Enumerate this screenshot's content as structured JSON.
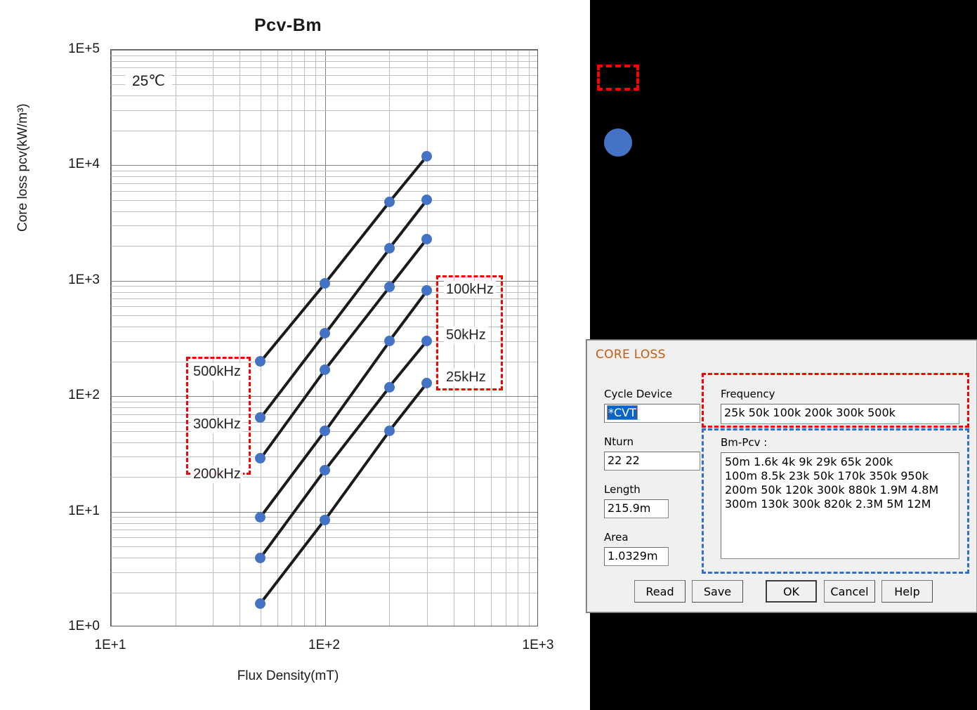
{
  "chart_data": {
    "type": "line",
    "title": "Pcv-Bm",
    "xlabel": "Flux Density(mT)",
    "ylabel": "Core loss pcv(kW/m³)",
    "annotation": "25℃",
    "xscale": "log",
    "yscale": "log",
    "xlim": [
      10,
      1000
    ],
    "ylim": [
      1,
      100000
    ],
    "grid": true,
    "xtick_labels": [
      "1E+1",
      "1E+2",
      "1E+3"
    ],
    "ytick_labels": [
      "1E+0",
      "1E+1",
      "1E+2",
      "1E+3",
      "1E+4",
      "1E+5"
    ],
    "x": [
      50,
      100,
      200,
      300
    ],
    "marker_color": "#4472C4",
    "line_color": "#1a1a1a",
    "legend_position": "inline-labels",
    "series": [
      {
        "name": "25kHz",
        "label_side": "right",
        "values": [
          1.6,
          8.5,
          50,
          130
        ]
      },
      {
        "name": "50kHz",
        "label_side": "right",
        "values": [
          4,
          23,
          120,
          300
        ]
      },
      {
        "name": "100kHz",
        "label_side": "right",
        "values": [
          9,
          50,
          300,
          820
        ]
      },
      {
        "name": "200kHz",
        "label_side": "left",
        "values": [
          29,
          170,
          880,
          2300
        ]
      },
      {
        "name": "300kHz",
        "label_side": "left",
        "values": [
          65,
          350,
          1900,
          5000
        ]
      },
      {
        "name": "500kHz",
        "label_side": "left",
        "values": [
          200,
          950,
          4800,
          12000
        ]
      }
    ],
    "left_label_group": [
      "500kHz",
      "300kHz",
      "200kHz"
    ],
    "right_label_group": [
      "100kHz",
      "50kHz",
      "25kHz"
    ]
  },
  "dialog": {
    "title": "CORE LOSS",
    "fields": [
      {
        "label": "Cycle Device",
        "value": "*CVT",
        "selected": true
      },
      {
        "label": "Nturn",
        "value": "22 22",
        "selected": false
      },
      {
        "label": "Length",
        "value": "215.9m",
        "selected": false
      },
      {
        "label": "Area",
        "value": "1.0329m",
        "selected": false
      }
    ],
    "frequency": {
      "label": "Frequency",
      "value": "25k 50k 100k 200k 300k 500k"
    },
    "bm_pcv": {
      "label": "Bm-Pcv :",
      "lines": [
        "50m 1.6k 4k 9k 29k 65k 200k",
        "100m 8.5k 23k 50k 170k 350k 950k",
        "200m 50k 120k 300k 880k 1.9M 4.8M",
        "300m 130k 300k 820k 2.3M 5M 12M"
      ],
      "text": "50m 1.6k 4k 9k 29k 65k 200k\n100m 8.5k 23k 50k 170k 350k 950k\n200m 50k 120k 300k 880k 1.9M 4.8M\n300m 130k 300k 820k 2.3M 5M 12M"
    },
    "buttons": [
      {
        "label": "Read",
        "default": false
      },
      {
        "label": "Save",
        "default": false
      },
      {
        "label": "OK",
        "default": true
      },
      {
        "label": "Cancel",
        "default": false
      },
      {
        "label": "Help",
        "default": false
      }
    ]
  },
  "highlights": {
    "accent_red": "#FF0000",
    "accent_blue": "#2E6ED5",
    "marker_blue": "#4472C4"
  }
}
